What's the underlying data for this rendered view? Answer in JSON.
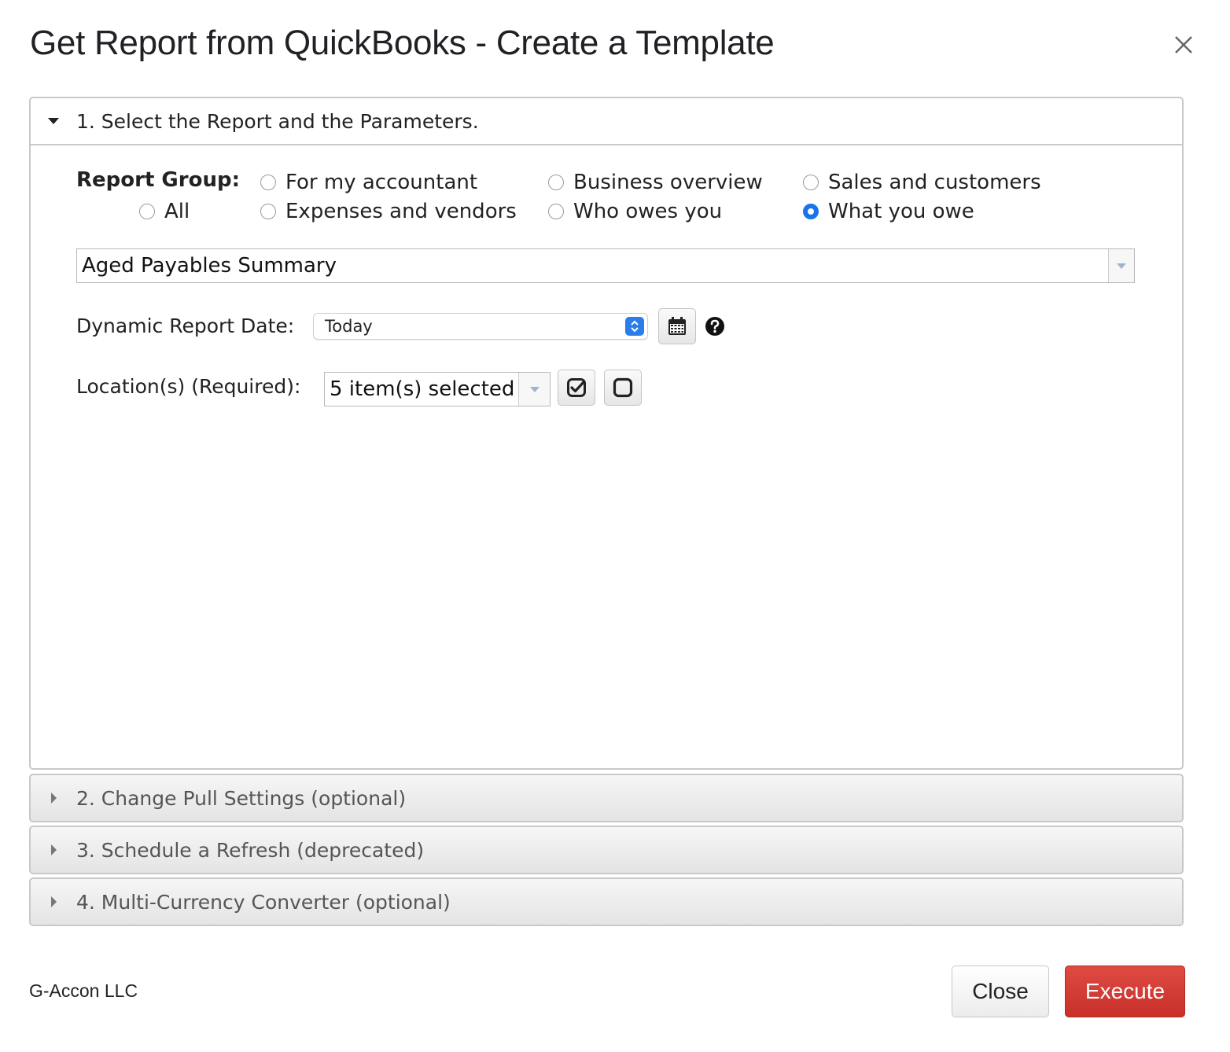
{
  "dialog": {
    "title": "Get Report from QuickBooks - Create a Template",
    "close_icon": "close-icon"
  },
  "sections": [
    {
      "label": "1. Select the Report and the Parameters.",
      "expanded": true
    },
    {
      "label": "2. Change Pull Settings (optional)",
      "expanded": false
    },
    {
      "label": "3. Schedule a Refresh (deprecated)",
      "expanded": false
    },
    {
      "label": "4. Multi-Currency Converter (optional)",
      "expanded": false
    }
  ],
  "report_group": {
    "label": "Report Group:",
    "options": [
      {
        "label": "All",
        "checked": false
      },
      {
        "label": "For my accountant",
        "checked": false
      },
      {
        "label": "Expenses and vendors",
        "checked": false
      },
      {
        "label": "Business overview",
        "checked": false
      },
      {
        "label": "Who owes you",
        "checked": false
      },
      {
        "label": "Sales and customers",
        "checked": false
      },
      {
        "label": "What you owe",
        "checked": true
      }
    ]
  },
  "report": {
    "selected": "Aged Payables Summary"
  },
  "dynamic_date": {
    "label": "Dynamic Report Date:",
    "value": "Today"
  },
  "locations": {
    "label": "Location(s) (Required):",
    "value": "5 item(s) selected"
  },
  "footer": {
    "company": "G-Accon LLC",
    "close_label": "Close",
    "execute_label": "Execute"
  },
  "colors": {
    "accent": "#1a73e8",
    "execute": "#d13c35"
  }
}
